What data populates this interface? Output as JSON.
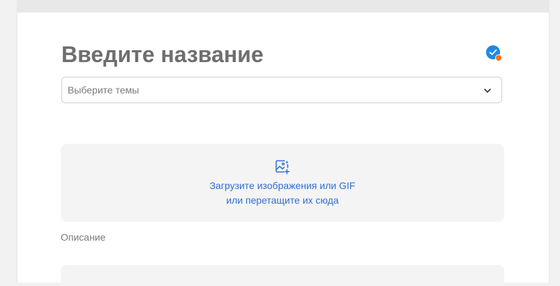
{
  "editor": {
    "title": "Введите название",
    "topics": {
      "placeholder": "Выберите темы"
    },
    "upload": {
      "line1": "Загрузите изображения или GIF",
      "line2": "или перетащите их сюда"
    },
    "description": {
      "label": "Описание"
    },
    "status_icon": "check-badge-icon"
  },
  "colors": {
    "accent": "#1e88e5",
    "status_dot": "#ff6d1b",
    "link": "#2f6fd6",
    "title": "#6e6e6e"
  }
}
